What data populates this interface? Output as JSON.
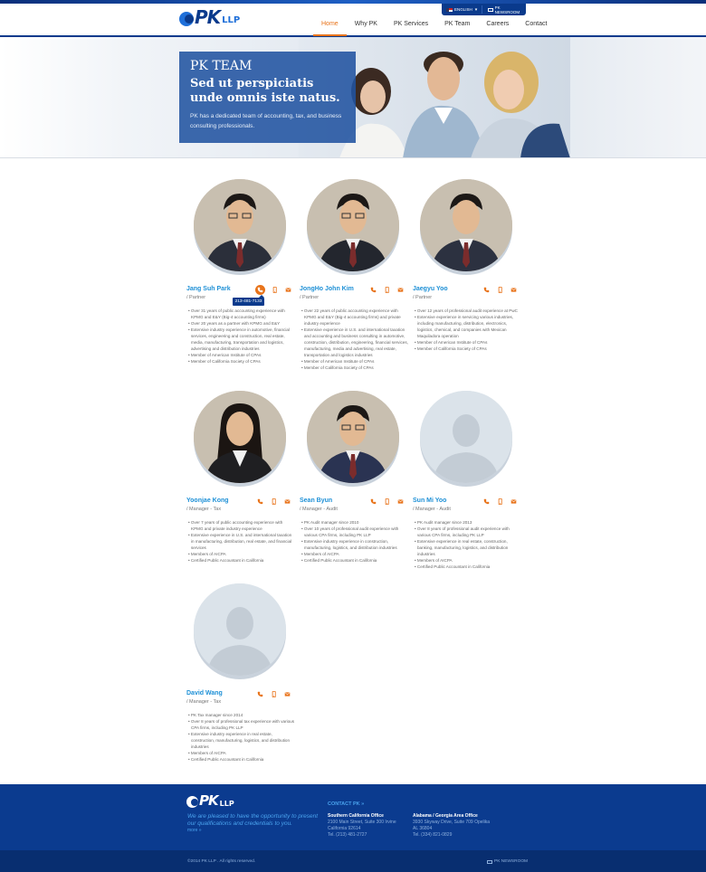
{
  "header": {
    "logo_text": "PK",
    "logo_suffix": "LLP",
    "language_label": "ENGLISH",
    "newsroom_label": "PK NEWSROOM",
    "nav": [
      "Home",
      "Why PK",
      "PK Services",
      "PK Team",
      "Careers",
      "Contact"
    ],
    "active_nav": "Home"
  },
  "hero": {
    "kicker": "PK TEAM",
    "title": "Sed ut perspiciatis unde omnis iste natus.",
    "description": "PK has a dedicated team of accounting, tax, and business consulting professionals."
  },
  "tooltip": "213-481-7133",
  "members": [
    {
      "name": "Jang Suh Park",
      "role": "/ Partner",
      "bullets": [
        "Over 31 years of public accounting experience with KPMG and E&Y (Big-4 accounting firms)",
        "Over 20 years as a partner with KPMG and E&Y",
        "Extensive industry experience in automotive, financial services, engineering and construction, real estate, media, manufacturing, transportation and logistics, advertising and distribution industries",
        "Member of American Institute of CPAs",
        "Member of California Society of CPAs"
      ]
    },
    {
      "name": "JongHo John Kim",
      "role": "/ Partner",
      "bullets": [
        "Over 22 years of public accounting experience with KPMG and E&Y (Big-4 accounting firms) and private industry experience",
        "Extensive experience in U.S. and international taxation and accounting and business consulting in automotive, construction, distribution, engineering, financial services, manufacturing, media and advertising, real estate, transportation and logistics industries",
        "Member of American Institute of CPAs",
        "Member of California Society of CPAs"
      ]
    },
    {
      "name": "Jaegyu Yoo",
      "role": "/ Partner",
      "bullets": [
        "Over 12 years of professional audit experience at PwC",
        "Extensive experience in servicing various industries, including manufacturing, distribution, electronics, logistics, chemical, and companies with Mexican Maquiladora operation",
        "Member of American Institute of CPAs",
        "Member of California Society of CPAs"
      ]
    },
    {
      "name": "Yoonjae Kong",
      "role": "/ Manager - Tax",
      "bullets": [
        "Over 7 years of public accounting experience with KPMG and private industry experience",
        "Extensive experience in U.S. and international taxation in manufacturing, distribution, real estate, and financial services",
        "Members of AICPA",
        "Certified Public Accountant in California"
      ]
    },
    {
      "name": "Sean Byun",
      "role": "/ Manager - Audit",
      "bullets": [
        "PK Audit manager since 2010",
        "Over 10 years of professional audit experience with various CPA firms, including PK LLP",
        "Extensive industry experience in construction, manufacturing, logistics, and distribution industries",
        "Members of AICPA",
        "Certified Public Accountant in California"
      ]
    },
    {
      "name": "Sun Mi Yoo",
      "role": "/ Manager - Audit",
      "bullets": [
        "PK Audit manager since 2013",
        "Over 8 years of professional audit experience with various CPA firms, including PK LLP",
        "Extensive experience in real estate, construction, banking, manufacturing, logistics, and distribution industries",
        "Members of AICPA",
        "Certified Public Accountant in California"
      ]
    },
    {
      "name": "David Wang",
      "role": "/ Manager - Tax",
      "bullets": [
        "PK Tax manager since 2014",
        "Over 8 years of professional tax experience with various CPA firms, including PK LLP",
        "Extensive industry experience in real estate, construction, manufacturing, logistics, and distribution industries",
        "Members of AICPA",
        "Certified Public Accountant in California"
      ]
    }
  ],
  "footer": {
    "logo_text": "PK",
    "logo_suffix": "LLP",
    "tagline": "We are pleased to have the opportunity to present our qualifications and credentials to you.",
    "more": "more »",
    "contact_heading": "CONTACT PK »",
    "offices": [
      {
        "title": "Southern California Office",
        "lines": [
          "2100 Main Street, Suite 300 Irvine",
          "California 92614",
          "Tel. (213) 481-2727"
        ]
      },
      {
        "title": "Alabama / Georgia Area Office",
        "lines": [
          "3930 Skyway Drive, Suite 709 Opelika",
          "AL 36804",
          "Tel. (334) 821-0829"
        ]
      }
    ],
    "copyright": "©2014 PK LLP . All rights reserved.",
    "newsroom": "PK NEWSROOM"
  },
  "colors": {
    "brand_navy": "#0a3a8c",
    "accent_orange": "#e8731a",
    "name_blue": "#1e90d6"
  }
}
